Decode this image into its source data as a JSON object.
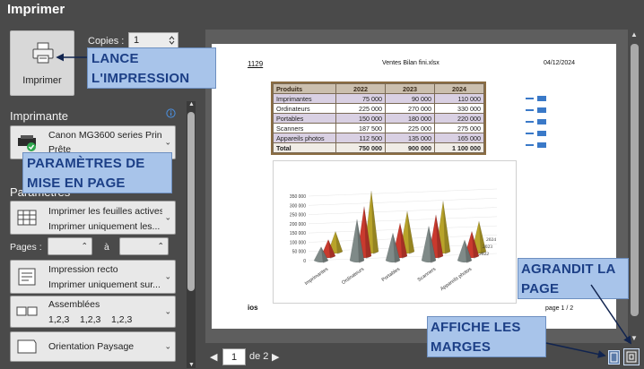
{
  "window": {
    "title": "Imprimer"
  },
  "print_button": {
    "label": "Imprimer",
    "icon": "printer-icon"
  },
  "copies": {
    "label": "Copies :",
    "value": "1"
  },
  "printer": {
    "section_title": "Imprimante",
    "name": "Canon MG3600 series Prin...",
    "status": "Prête"
  },
  "parameters": {
    "section_title": "Paramètres",
    "what_to_print": {
      "line1": "Imprimer les feuilles actives",
      "line2": "Imprimer uniquement les..."
    },
    "pages": {
      "label": "Pages :",
      "to": "à"
    },
    "sides": {
      "line1": "Impression recto",
      "line2": "Imprimer uniquement sur..."
    },
    "collation": {
      "line1": "Assemblées",
      "line2": "1,2,3    1,2,3    1,2,3"
    },
    "orientation": {
      "line1": "Orientation Paysage"
    }
  },
  "callouts": {
    "print": "LANCE\nL'IMPRESSION",
    "layout": "PARAMÈTRES DE\nMISE EN PAGE",
    "zoom": "AGRANDIT LA\nPAGE",
    "margins": "AFFICHE LES\nMARGES"
  },
  "document": {
    "header_left": "1129",
    "header_center": "Ventes Bilan fini.xlsx",
    "header_right": "04/12/2024",
    "footer_left": "ios",
    "footer_right": "page 1 / 2"
  },
  "table": {
    "headers": [
      "Produits",
      "2022",
      "2023",
      "2024"
    ],
    "rows": [
      [
        "Imprimantes",
        "75 000",
        "90 000",
        "110 000"
      ],
      [
        "Ordinateurs",
        "225 000",
        "270 000",
        "330 000"
      ],
      [
        "Portables",
        "150 000",
        "180 000",
        "220 000"
      ],
      [
        "Scanners",
        "187 500",
        "225 000",
        "275 000"
      ],
      [
        "Appareils photos",
        "112 500",
        "135 000",
        "165 000"
      ],
      [
        "Total",
        "750 000",
        "900 000",
        "1 100 000"
      ]
    ]
  },
  "chart_data": {
    "type": "bar",
    "categories": [
      "Imprimantes",
      "Ordinateurs",
      "Portables",
      "Scanners",
      "Appareils photos"
    ],
    "series": [
      {
        "name": "2022",
        "values": [
          75000,
          225000,
          150000,
          187500,
          112500
        ],
        "color": "#7f8a88"
      },
      {
        "name": "2023",
        "values": [
          90000,
          270000,
          180000,
          225000,
          135000
        ],
        "color": "#c93a2e"
      },
      {
        "name": "2024",
        "values": [
          110000,
          330000,
          220000,
          275000,
          165000
        ],
        "color": "#b8a32a"
      }
    ],
    "ylim": [
      0,
      350000
    ],
    "yticks": [
      "0",
      "50 000",
      "100 000",
      "150 000",
      "200 000",
      "250 000",
      "300 000",
      "350 000"
    ],
    "depth_labels": [
      "2024",
      "2023",
      "2022"
    ]
  },
  "page_nav": {
    "current": "1",
    "of_label": "de 2"
  },
  "colors": {
    "background": "#4a4a4a",
    "callout_bg": "#a8c4ea",
    "callout_text": "#1c3f86"
  }
}
